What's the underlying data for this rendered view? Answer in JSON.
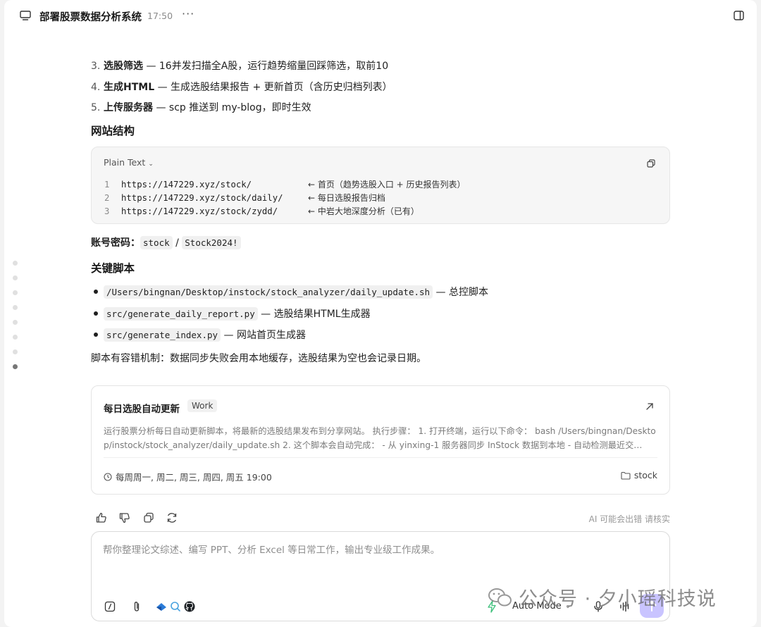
{
  "header": {
    "title": "部署股票数据分析系统",
    "time": "17:50",
    "more": "···"
  },
  "steps": [
    {
      "num": "3.",
      "bold": "选股筛选",
      "rest": " — 16并发扫描全A股，运行趋势缩量回踩筛选，取前10"
    },
    {
      "num": "4.",
      "bold": "生成HTML",
      "rest": " — 生成选股结果报告 + 更新首页（含历史归档列表）"
    },
    {
      "num": "5.",
      "bold": "上传服务器",
      "rest": " — scp 推送到 my-blog，即时生效"
    }
  ],
  "site_section": {
    "heading": "网站结构",
    "code_lang": "Plain Text",
    "lines": [
      {
        "n": "1",
        "url": "https://147229.xyz/stock/",
        "comment": "← 首页（趋势选股入口 + 历史报告列表）"
      },
      {
        "n": "2",
        "url": "https://147229.xyz/stock/daily/",
        "comment": "← 每日选股报告归档"
      },
      {
        "n": "3",
        "url": "https://147229.xyz/stock/zydd/",
        "comment": "← 中岩大地深度分析（已有）"
      }
    ]
  },
  "account": {
    "label": "账号密码：",
    "user": "stock",
    "sep": " / ",
    "password": "Stock2024!"
  },
  "scripts_section": {
    "heading": "关键脚本",
    "items": [
      {
        "code": "/Users/bingnan/Desktop/instock/stock_analyzer/daily_update.sh",
        "desc": " — 总控脚本"
      },
      {
        "code": "src/generate_daily_report.py",
        "desc": " — 选股结果HTML生成器"
      },
      {
        "code": "src/generate_index.py",
        "desc": " — 网站首页生成器"
      }
    ],
    "note": "脚本有容错机制：数据同步失败会用本地缓存，选股结果为空也会记录日期。"
  },
  "task_card": {
    "title": "每日选股自动更新",
    "badge": "Work",
    "description": "运行股票分析每日自动更新脚本，将最新的选股结果发布到分享网站。 执行步骤： 1. 打开终端，运行以下命令： bash /Users/bingnan/Desktop/instock/stock_analyzer/daily_update.sh 2. 这个脚本会自动完成： - 从 yinxing-1 服务器同步 InStock 数据到本地 - 自动检测最近交…",
    "schedule": "每周周一, 周二, 周三, 周四, 周五 19:00",
    "folder": "stock"
  },
  "feedback": {
    "ai_note": "AI 可能会出错 请核实"
  },
  "composer": {
    "placeholder": "帮你整理论文综述、编写 PPT、分析 Excel 等日常工作，输出专业级工作成果。",
    "mode_label": "Auto Mode"
  },
  "watermark": {
    "text": "公众号 · 夕小瑶科技说"
  },
  "colors": {
    "accent": "#c9c4ff",
    "muted": "#8a8a8a"
  }
}
